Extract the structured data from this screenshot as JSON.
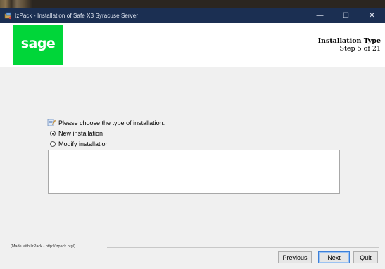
{
  "window": {
    "title": "IzPack - Installation of Safe X3 Syracuse Server",
    "controls": {
      "minimize": "—",
      "maximize": "☐",
      "close": "✕"
    }
  },
  "header": {
    "logo_text": "sage",
    "logo_color": "#00d639",
    "panel_title": "Installation Type",
    "step": "Step 5 of 21"
  },
  "main": {
    "prompt": "Please choose the type of installation:",
    "options": [
      {
        "label": "New installation",
        "selected": true
      },
      {
        "label": "Modify installation",
        "selected": false
      }
    ],
    "description": ""
  },
  "footer": {
    "made_with": "(Made with IzPack - http://izpack.org/)",
    "buttons": {
      "previous": "Previous",
      "next": "Next",
      "quit": "Quit"
    }
  },
  "icons": [
    "izpack-app-icon",
    "document-edit-icon",
    "radio-icon"
  ],
  "colors": {
    "titlebar": "#1b2f52",
    "accent": "#3c7fd9"
  }
}
